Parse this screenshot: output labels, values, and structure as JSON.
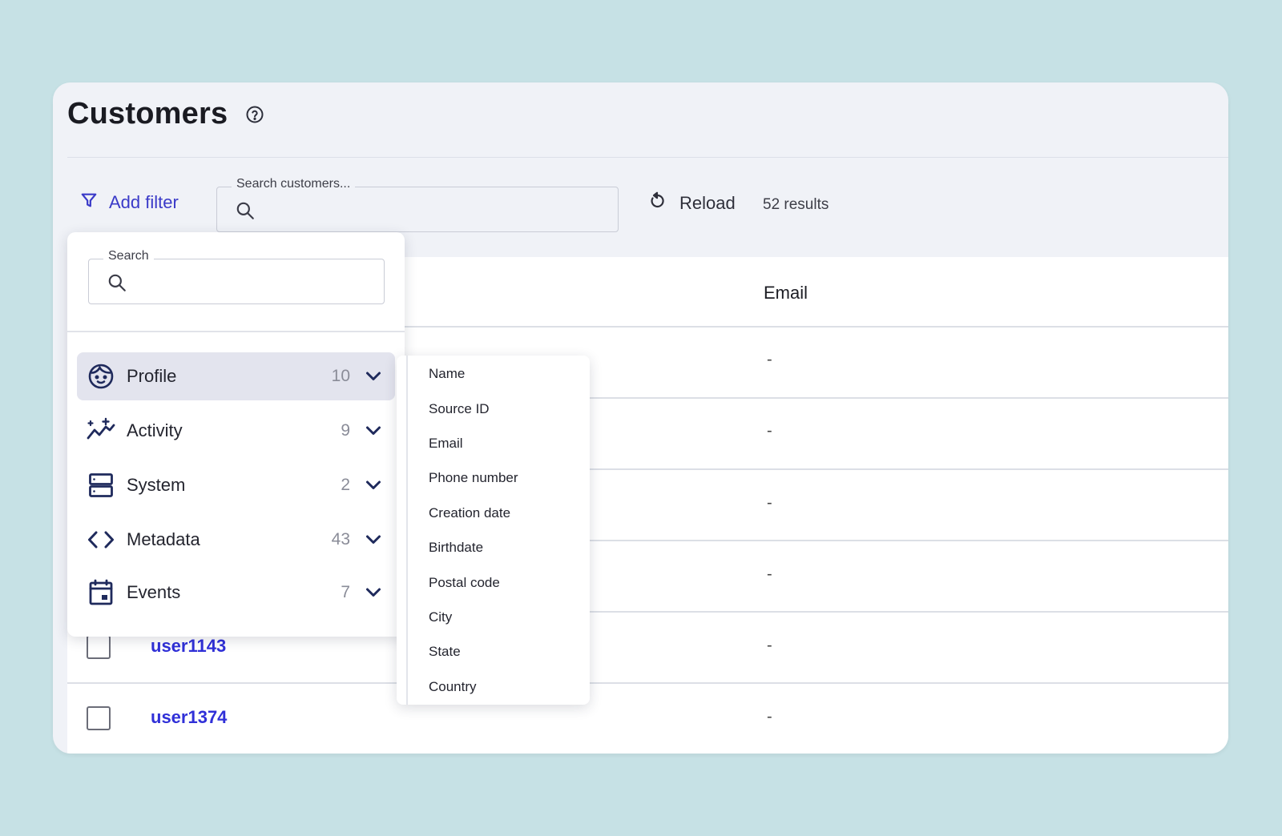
{
  "page": {
    "title": "Customers",
    "help_icon": "help-circle-icon"
  },
  "toolbar": {
    "add_filter_label": "Add filter",
    "search_legend": "Search customers...",
    "reload_label": "Reload",
    "results_text": "52 results"
  },
  "table": {
    "columns": [
      "Email"
    ],
    "rows": [
      {
        "user": "",
        "email": "-"
      },
      {
        "user": "",
        "email": "-"
      },
      {
        "user": "",
        "email": "-"
      },
      {
        "user": "",
        "email": "-"
      },
      {
        "user": "user1143",
        "email": "-"
      },
      {
        "user": "user1374",
        "email": "-"
      }
    ]
  },
  "filter_panel": {
    "search_legend": "Search",
    "categories": [
      {
        "label": "Profile",
        "count": "10",
        "icon": "face-icon"
      },
      {
        "label": "Activity",
        "count": "9",
        "icon": "activity-sparkle-icon"
      },
      {
        "label": "System",
        "count": "2",
        "icon": "server-icon"
      },
      {
        "label": "Metadata",
        "count": "43",
        "icon": "code-brackets-icon"
      },
      {
        "label": "Events",
        "count": "7",
        "icon": "calendar-event-icon"
      }
    ],
    "active_category": "Profile"
  },
  "submenu": {
    "items": [
      "Name",
      "Source ID",
      "Email",
      "Phone number",
      "Creation date",
      "Birthdate",
      "Postal code",
      "City",
      "State",
      "Country"
    ]
  },
  "colors": {
    "background": "#c6e1e5",
    "accent": "#3a3ac8",
    "link": "#3030d8",
    "icon_navy": "#1f2a5c"
  }
}
